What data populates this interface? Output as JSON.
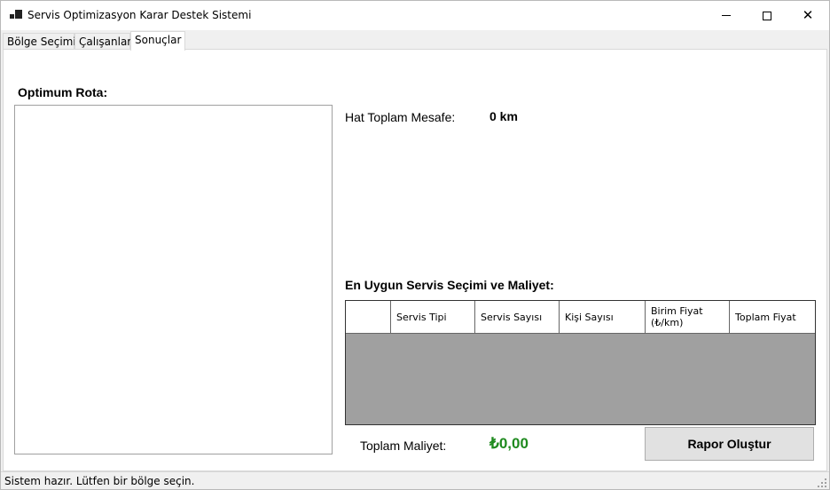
{
  "window": {
    "title": "Servis Optimizasyon Karar Destek Sistemi",
    "close_glyph": "✕"
  },
  "tabs": [
    {
      "label": "Bölge Seçimi"
    },
    {
      "label": "Çalışanlar"
    },
    {
      "label": "Sonuçlar"
    }
  ],
  "active_tab": "Sonuçlar",
  "results": {
    "route_label": "Optimum Rota:",
    "distance_label": "Hat Toplam Mesafe:",
    "distance_value": "0 km",
    "service_label": "En Uygun Servis Seçimi ve Maliyet:",
    "grid_columns": [
      "",
      "Servis Tipi",
      "Servis Sayısı",
      "Kişi Sayısı",
      "Birim Fiyat (₺/km)",
      "Toplam Fiyat"
    ],
    "total_cost_label": "Toplam Maliyet:",
    "total_cost_value": "₺0,00",
    "report_button": "Rapor Oluştur"
  },
  "status": {
    "text": "Sistem hazır. Lütfen bir bölge seçin."
  },
  "colors": {
    "cost_green": "#1f8a1f",
    "grid_empty": "#a0a0a0"
  }
}
